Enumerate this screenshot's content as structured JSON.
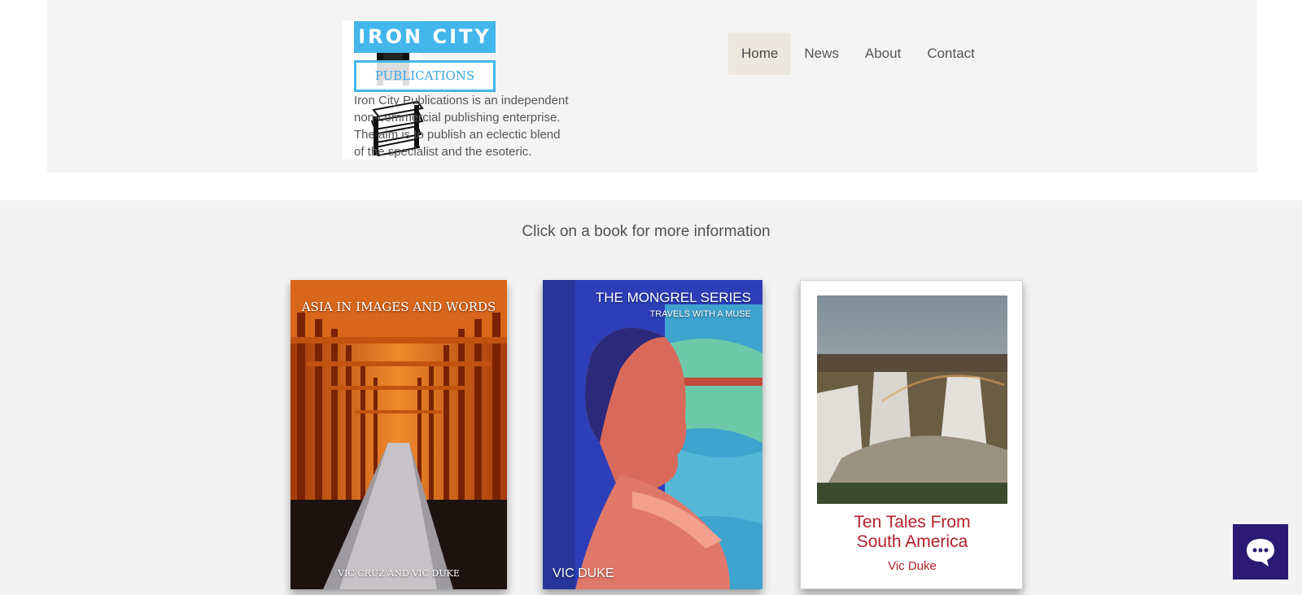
{
  "brand": {
    "title": "IRON CITY",
    "subtitle": "PUBLICATIONS",
    "description": "Iron City Publications is an independent non-commercial publishing enterprise. The aim is to publish an eclectic blend of the specialist and the esoteric."
  },
  "nav": {
    "items": [
      {
        "label": "Home",
        "active": true
      },
      {
        "label": "News",
        "active": false
      },
      {
        "label": "About",
        "active": false
      },
      {
        "label": "Contact",
        "active": false
      }
    ]
  },
  "gallery": {
    "instruction": "Click on a book for more information",
    "books": [
      {
        "title": "ASIA IN IMAGES AND WORDS",
        "authors": "VIC CRUZ AND VIC DUKE"
      },
      {
        "series": "THE MONGREL SERIES",
        "subtitle": "TRAVELS WITH A MUSE",
        "author": "VIC DUKE"
      },
      {
        "title_line1": "Ten Tales From",
        "title_line2": "South America",
        "author": "Vic Duke"
      }
    ]
  },
  "colors": {
    "brand_blue": "#43b6ec",
    "nav_active_bg": "#ece8de",
    "chat_bg": "#2b1a73",
    "book3_title": "#b3202a"
  },
  "icons": {
    "chat": "chat-bubble-icon",
    "logo_art": "stacked-books-icon"
  }
}
